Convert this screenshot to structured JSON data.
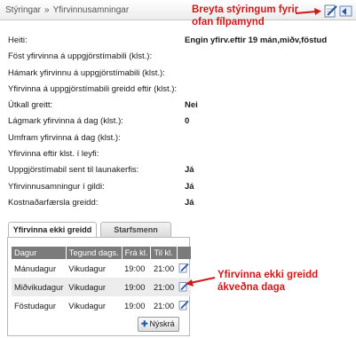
{
  "breadcrumb": {
    "sep": "»",
    "items": [
      "Stýringar",
      "Yfirvinnusamningar"
    ]
  },
  "annotations": {
    "top": [
      "Breyta stýringum fyrir",
      "ofan fílpamynd"
    ],
    "bottom": [
      "Yfirvinna ekki greidd",
      "ákveðna daga"
    ],
    "color": "#cc1a1a"
  },
  "header_icons": [
    "edit-icon",
    "back-icon"
  ],
  "fields": [
    {
      "label": "Heiti:",
      "value": "Engin yfirv.eftir 19 mán,miðv,föstud"
    },
    {
      "label": "Föst yfirvinna á uppgjörstímabili (klst.):",
      "value": ""
    },
    {
      "label": "Hámark yfirvinnu á uppgjörstímabili (klst.):",
      "value": ""
    },
    {
      "label": "Yfirvinna á uppgjörstímabili greidd eftir (klst.):",
      "value": ""
    },
    {
      "label": "Útkall greitt:",
      "value": "Nei"
    },
    {
      "label": "Lágmark yfirvinna á dag (klst.):",
      "value": "0"
    },
    {
      "label": "Umfram yfirvinna á dag (klst.):",
      "value": ""
    },
    {
      "label": "Yfirvinna eftir klst. í leyfi:",
      "value": ""
    },
    {
      "label": "Uppgjörstímabil sent til launakerfis:",
      "value": "Já"
    },
    {
      "label": "Yfirvinnusamningur í gildi:",
      "value": "Já"
    },
    {
      "label": "Kostnaðarfærsla greidd:",
      "value": "Já"
    }
  ],
  "tabs": [
    {
      "label": "Yfirvinna ekki greidd",
      "active": true
    },
    {
      "label": "Starfsmenn",
      "active": false
    }
  ],
  "table": {
    "columns": [
      "Dagur",
      "Tegund dags.",
      "Frá kl.",
      "Til kl."
    ],
    "rows": [
      {
        "dagur": "Mánudagur",
        "tegund": "Vikudagur",
        "fra": "19:00",
        "til": "21:00"
      },
      {
        "dagur": "Miðvikudagur",
        "tegund": "Vikudagur",
        "fra": "19:00",
        "til": "21:00"
      },
      {
        "dagur": "Föstudagur",
        "tegund": "Vikudagur",
        "fra": "19:00",
        "til": "21:00"
      }
    ]
  },
  "new_button": "Nýskrá"
}
